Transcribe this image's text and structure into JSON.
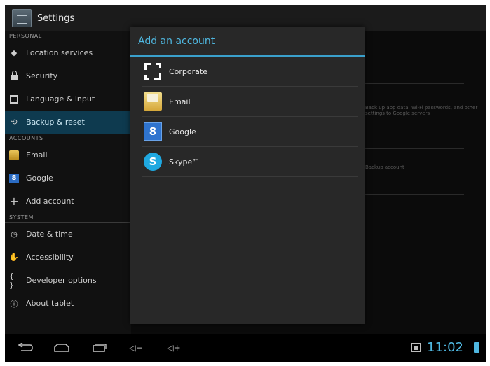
{
  "app": {
    "title": "Settings"
  },
  "sidebar": {
    "sections": [
      {
        "header": "PERSONAL",
        "items": [
          {
            "label": "Location services",
            "icon": "location-icon"
          },
          {
            "label": "Security",
            "icon": "lock-icon"
          },
          {
            "label": "Language & input",
            "icon": "keyboard-icon"
          },
          {
            "label": "Backup & reset",
            "icon": "backup-icon",
            "active": true
          }
        ]
      },
      {
        "header": "ACCOUNTS",
        "items": [
          {
            "label": "Email",
            "icon": "email-icon"
          },
          {
            "label": "Google",
            "icon": "google-icon"
          },
          {
            "label": "Add account",
            "icon": "plus-icon"
          }
        ]
      },
      {
        "header": "SYSTEM",
        "items": [
          {
            "label": "Date & time",
            "icon": "clock-icon"
          },
          {
            "label": "Accessibility",
            "icon": "hand-icon"
          },
          {
            "label": "Developer options",
            "icon": "braces-icon"
          },
          {
            "label": "About tablet",
            "icon": "info-icon"
          }
        ]
      }
    ]
  },
  "content": {
    "ghost_text_1": "Back up app data, Wi-Fi passwords, and other settings to Google servers",
    "ghost_text_2": "Backup account"
  },
  "dialog": {
    "title": "Add an account",
    "accounts": [
      {
        "label": "Corporate",
        "icon": "corporate-icon"
      },
      {
        "label": "Email",
        "icon": "email-icon"
      },
      {
        "label": "Google",
        "icon": "google-icon",
        "glyph": "8"
      },
      {
        "label": "Skype™",
        "icon": "skype-icon",
        "glyph": "S"
      }
    ]
  },
  "systembar": {
    "time": "11:02",
    "back_glyph": "⟲",
    "volume_down_glyph": "◁−",
    "volume_up_glyph": "◁+"
  },
  "colors": {
    "accent": "#4fb7e0",
    "sidebar_active": "#0e3a4f",
    "dialog_bg": "#282828"
  }
}
